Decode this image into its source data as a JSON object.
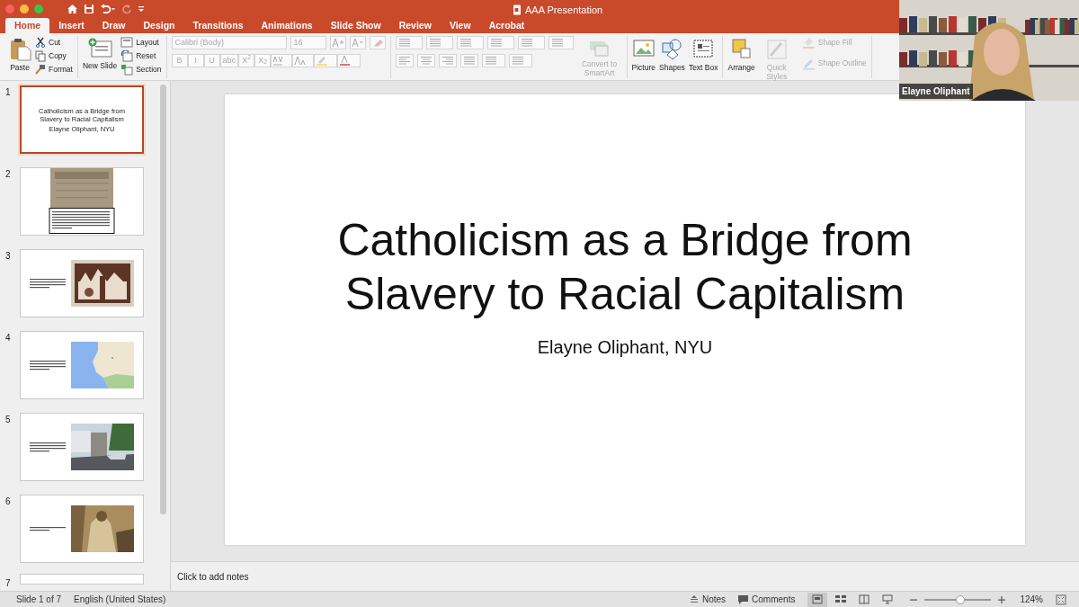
{
  "window": {
    "title": "AAA Presentation"
  },
  "tabs": [
    {
      "label": "Home",
      "selected": true
    },
    {
      "label": "Insert",
      "selected": false
    },
    {
      "label": "Draw",
      "selected": false
    },
    {
      "label": "Design",
      "selected": false
    },
    {
      "label": "Transitions",
      "selected": false
    },
    {
      "label": "Animations",
      "selected": false
    },
    {
      "label": "Slide Show",
      "selected": false
    },
    {
      "label": "Review",
      "selected": false
    },
    {
      "label": "View",
      "selected": false
    },
    {
      "label": "Acrobat",
      "selected": false
    }
  ],
  "clipboard": {
    "paste": "Paste",
    "items": [
      {
        "kind": "cut",
        "label": "Cut"
      },
      {
        "kind": "copy",
        "label": "Copy"
      },
      {
        "kind": "format",
        "label": "Format"
      }
    ]
  },
  "slides_group": {
    "new_slide": "New Slide",
    "items": [
      {
        "kind": "layout",
        "label": "Layout"
      },
      {
        "kind": "reset",
        "label": "Reset"
      },
      {
        "kind": "section",
        "label": "Section"
      }
    ]
  },
  "font": {
    "name": "Calibri (Body)",
    "size": "16",
    "disabled": true,
    "styles": [
      "B",
      "I",
      "U",
      "abc",
      "X$^{2}$",
      "X$_{2}$"
    ]
  },
  "paragraph": {
    "convert": "Convert to SmartArt",
    "disabled": true
  },
  "insert": [
    {
      "kind": "picture",
      "label": "Picture",
      "disabled": false
    },
    {
      "kind": "shapes",
      "label": "Shapes",
      "disabled": false
    },
    {
      "kind": "textbox",
      "label": "Text Box",
      "disabled": false
    },
    {
      "kind": "arrange",
      "label": "Arrange",
      "disabled": false
    },
    {
      "kind": "styles",
      "label": "Quick Styles",
      "disabled": true
    }
  ],
  "shape_format": [
    {
      "kind": "fill",
      "label": "Shape Fill",
      "disabled": true
    },
    {
      "kind": "outline",
      "label": "Shape Outline",
      "disabled": true
    }
  ],
  "video": {
    "name": "Elayne Oliphant"
  },
  "thumbnails": [
    {
      "number": "1",
      "selected": true,
      "kind": "title",
      "title": "Catholicism as a Bridge from Slavery to Racial Capitalism",
      "subtitle": "Elayne Oliphant, NYU"
    },
    {
      "number": "2",
      "selected": false,
      "kind": "document"
    },
    {
      "number": "3",
      "selected": false,
      "kind": "artwork"
    },
    {
      "number": "4",
      "selected": false,
      "kind": "map"
    },
    {
      "number": "5",
      "selected": false,
      "kind": "street"
    },
    {
      "number": "6",
      "selected": false,
      "kind": "engraving"
    },
    {
      "number": "7",
      "selected": false,
      "kind": "cut"
    }
  ],
  "slide": {
    "title": "Catholicism as a Bridge from\nSlavery to Racial Capitalism",
    "subtitle": "Elayne Oliphant, NYU"
  },
  "notes": {
    "placeholder": "Click to add notes"
  },
  "status_bar": {
    "slide_info": "Slide 1 of 7",
    "language": "English (United States)",
    "notes": "Notes",
    "comments": "Comments",
    "views": [
      {
        "kind": "normal",
        "selected": true
      },
      {
        "kind": "sorter",
        "selected": false
      },
      {
        "kind": "reading",
        "selected": false
      },
      {
        "kind": "slideshow",
        "selected": false
      }
    ],
    "zoom": {
      "level": 0.53,
      "reading": "124%"
    }
  }
}
